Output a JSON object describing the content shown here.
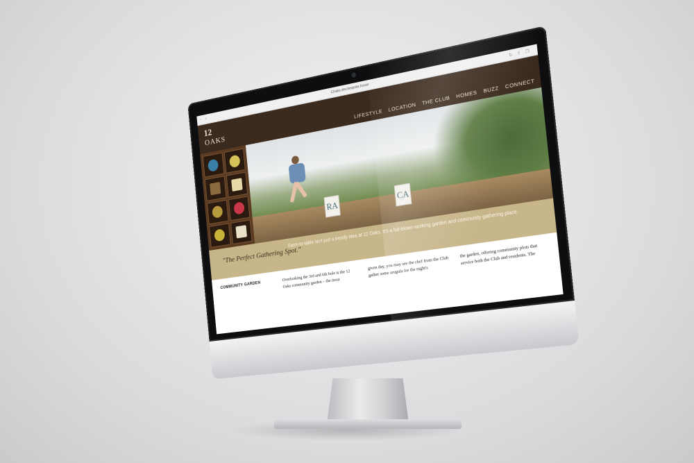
{
  "browser": {
    "url": "12oaks.dev.bespoke.house",
    "back_icon": "back-arrow-icon",
    "forward_icon": "forward-arrow-icon",
    "reload_icon": "reload-icon",
    "share_icon": "share-icon",
    "tabs_icon": "tabs-icon"
  },
  "site": {
    "logo_number": "12",
    "logo_text": "OAKS",
    "nav": [
      "LIFESTYLE",
      "LOCATION",
      "THE CLUB",
      "HOMES",
      "BUZZ",
      "CONNECT"
    ],
    "hero_signs": [
      "RA",
      "CA"
    ],
    "tagline": "Farm-to-table isn't just a trendy idea at 12 Oaks. It's a full-blown working garden and community gathering place.",
    "heading": "\"The Perfect Gathering Spot.\"",
    "section_label": "COMMUNITY GARDEN",
    "paragraphs": [
      "Overlooking the 3rd and 6th hole is the 12 Oaks community garden – the most",
      "given day, you may see the chef from the Club gather some arugula for the night's",
      "the garden, offering community plots that service both the Club and residents. The"
    ]
  },
  "colors": {
    "header_brown": "#3b2a1e",
    "band_tan": "#c8b68b",
    "nav_text": "#e9dfcd"
  }
}
